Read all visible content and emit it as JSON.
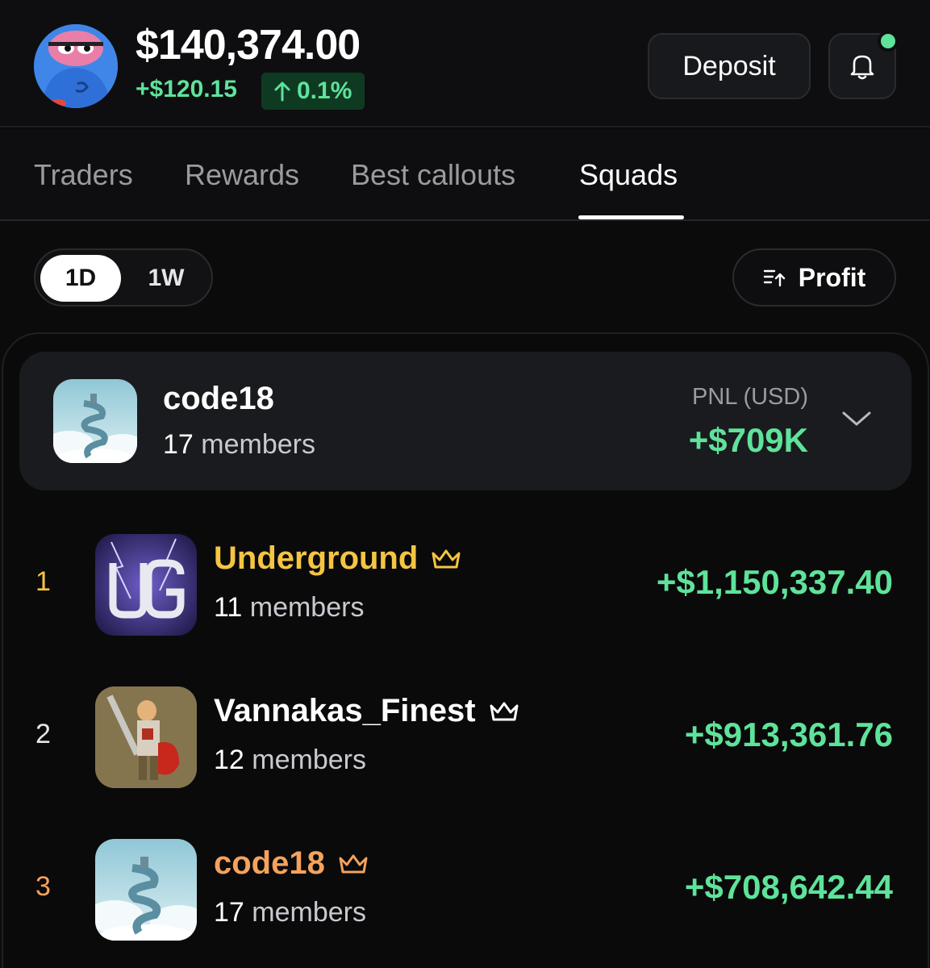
{
  "header": {
    "balance": "$140,374.00",
    "change_abs": "+$120.15",
    "change_pct": "0.1%",
    "deposit_label": "Deposit",
    "has_notification": true
  },
  "tabs": [
    {
      "label": "Traders",
      "active": false
    },
    {
      "label": "Rewards",
      "active": false
    },
    {
      "label": "Best callouts",
      "active": false
    },
    {
      "label": "Squads",
      "active": true
    }
  ],
  "period": {
    "options": [
      "1D",
      "1W"
    ],
    "selected": "1D"
  },
  "sort": {
    "label": "Profit",
    "icon": "sort-icon"
  },
  "my_squad": {
    "name": "code18",
    "members_count": "17",
    "members_word": "members",
    "pnl_label": "PNL (USD)",
    "pnl_value": "+$709K"
  },
  "leaderboard": [
    {
      "rank": "1",
      "name": "Underground",
      "members_count": "11",
      "members_word": "members",
      "pnl": "+$1,150,337.40",
      "rank_color": "#f5c542",
      "name_color": "#f5c542"
    },
    {
      "rank": "2",
      "name": "Vannakas_Finest",
      "members_count": "12",
      "members_word": "members",
      "pnl": "+$913,361.76",
      "rank_color": "#e6e6e8",
      "name_color": "#ffffff"
    },
    {
      "rank": "3",
      "name": "code18",
      "members_count": "17",
      "members_word": "members",
      "pnl": "+$708,642.44",
      "rank_color": "#f5a25d",
      "name_color": "#f5a25d"
    }
  ],
  "colors": {
    "positive": "#5ee39a",
    "gold": "#f5c542",
    "bronze": "#f5a25d",
    "background": "#0b0b0c"
  }
}
